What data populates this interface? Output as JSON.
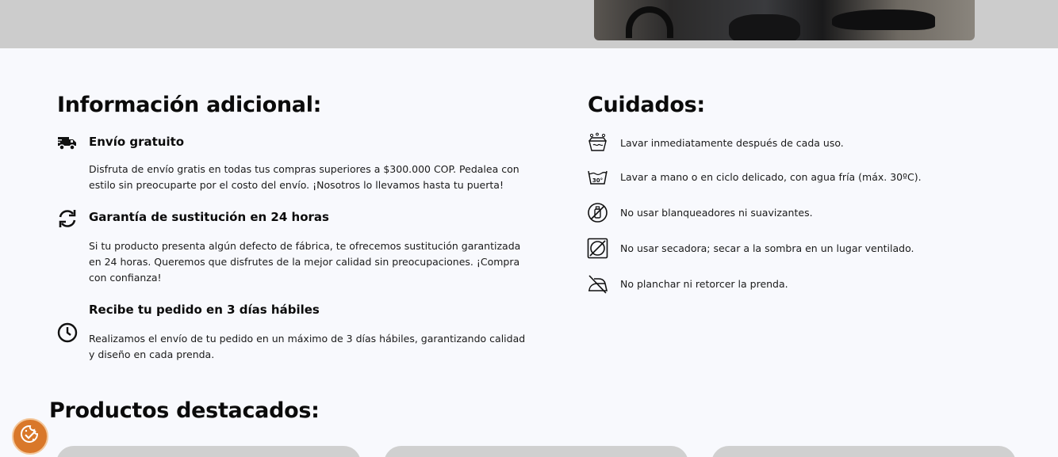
{
  "info": {
    "title": "Información adicional:",
    "items": [
      {
        "icon": "truck-icon",
        "title": "Envío gratuito",
        "text": "Disfruta de envío gratis en todas tus compras superiores a $300.000 COP. Pedalea con estilo sin preocuparte por el costo del envío. ¡Nosotros lo llevamos hasta tu puerta!"
      },
      {
        "icon": "refresh-icon",
        "title": "Garantía de sustitución en 24 horas",
        "text": "Si tu producto presenta algún defecto de fábrica, te ofrecemos sustitución garantizada en 24 horas. Queremos que disfrutes de la mejor calidad sin preocupaciones. ¡Compra con confianza!"
      },
      {
        "icon": "clock-icon",
        "title": "Recibe tu pedido en 3 días hábiles",
        "text": "Realizamos el envío de tu pedido en un máximo de 3 días hábiles, garantizando calidad y diseño en cada prenda."
      }
    ]
  },
  "care": {
    "title": "Cuidados:",
    "items": [
      {
        "icon": "wash-after-use-icon",
        "text": "Lavar inmediatamente después de cada uso."
      },
      {
        "icon": "wash-30-icon",
        "text": "Lavar a mano o en ciclo delicado, con agua fría (máx. 30ºC).",
        "badge": "30°"
      },
      {
        "icon": "no-bleach-icon",
        "text": "No usar blanqueadores ni suavizantes."
      },
      {
        "icon": "no-tumble-dry-icon",
        "text": "No usar secadora; secar a la sombra en un lugar ventilado."
      },
      {
        "icon": "no-iron-icon",
        "text": "No planchar ni retorcer la prenda."
      }
    ]
  },
  "featured": {
    "title": "Productos destacados:"
  },
  "colors": {
    "background": "#f8f9fd",
    "top_band": "#cccccc",
    "cookie_button": "#d9782a"
  }
}
